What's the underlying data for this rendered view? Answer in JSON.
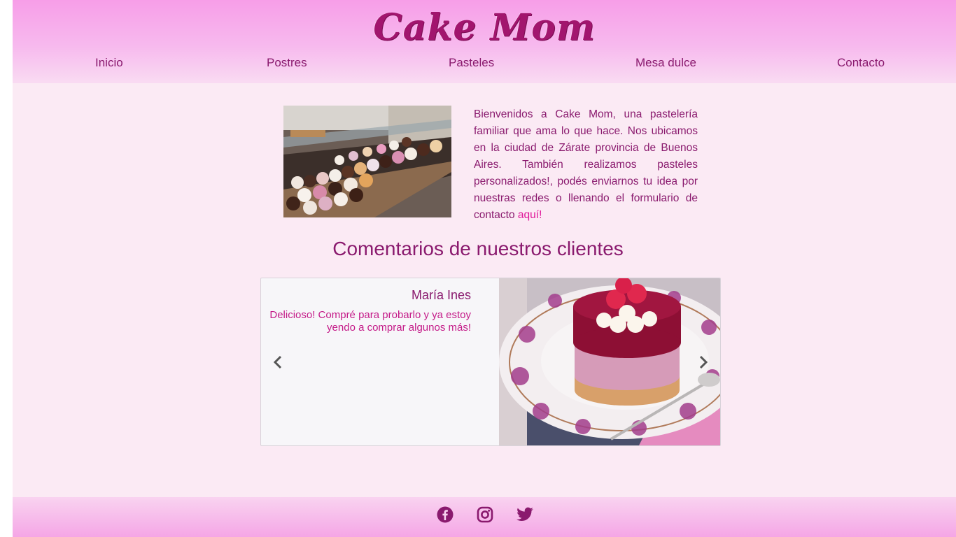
{
  "header": {
    "logo": "Cake Mom",
    "nav": [
      {
        "label": "Inicio"
      },
      {
        "label": "Postres"
      },
      {
        "label": "Pasteles"
      },
      {
        "label": "Mesa dulce"
      },
      {
        "label": "Contacto"
      }
    ]
  },
  "intro": {
    "text": "Bienvenidos a Cake Mom, una pastelería familiar que ama lo que hace. Nos ubicamos en la ciudad de Zárate provincia de Buenos Aires. También realizamos pasteles personalizados!, podés enviarnos tu idea por nuestras redes o llenando el formulario de contacto ",
    "link": "aquí!"
  },
  "reviews": {
    "title": "Comentarios de nuestros clientes",
    "current": {
      "name": "María Ines",
      "comment": "Delicioso! Compré para probarlo y ya estoy yendo a comprar algunos más!"
    }
  },
  "footer": {
    "social": [
      "facebook-icon",
      "instagram-icon",
      "twitter-icon"
    ]
  },
  "colors": {
    "accent": "#8a1a6e",
    "link": "#e0189a",
    "header_top": "#f79ee8",
    "background": "#fbeaf4"
  }
}
